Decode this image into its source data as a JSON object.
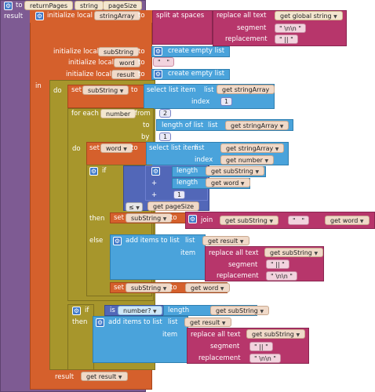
{
  "proc": {
    "to": "to",
    "name": "returnPages",
    "param1": "string",
    "param2": "pageSize",
    "result": "result"
  },
  "init": {
    "label": "initialize local",
    "var": "stringArray",
    "to": "to",
    "split": "split at spaces",
    "replace": "replace all text",
    "get": "get",
    "global": "global string",
    "segment": "segment",
    "replacement": "replacement",
    "seg_value": "\\n\\n",
    "rep_value": "||"
  },
  "locals": [
    {
      "label": "initialize local",
      "var": "subString",
      "to": "to",
      "value": "create empty list"
    },
    {
      "label": "initialize local",
      "var": "word",
      "to": "to",
      "value": ""
    },
    {
      "label": "initialize local",
      "var": "result",
      "to": "to",
      "value": "create empty list"
    }
  ],
  "in": "in",
  "do": "do",
  "set1": {
    "set": "set",
    "var": "subString",
    "to": "to",
    "select": "select list item",
    "list": "list",
    "get": "get",
    "listvar": "stringArray",
    "index": "index",
    "index_value": "1"
  },
  "foreach": {
    "label": "for each",
    "var": "number",
    "from": "from",
    "from_value": "2",
    "to": "to",
    "length": "length of list",
    "list": "list",
    "get": "get",
    "listvar": "stringArray",
    "by": "by",
    "by_value": "1",
    "do": "do"
  },
  "set2": {
    "set": "set",
    "var": "word",
    "to": "to",
    "select": "select list item",
    "list": "list",
    "get": "get",
    "listvar": "stringArray",
    "index": "index",
    "idxvar": "number"
  },
  "if1": {
    "if": "if",
    "length": "length",
    "get": "get",
    "a": "subString",
    "b": "word",
    "plus": "+",
    "one": "1",
    "le": "≤",
    "size": "pageSize"
  },
  "then1": {
    "then": "then",
    "set": "set",
    "var": "subString",
    "to": "to",
    "join": "join",
    "get": "get",
    "a": "subString",
    "sep": "",
    "b": "word"
  },
  "else1": {
    "else": "else",
    "add": "add items to list",
    "list": "list",
    "get": "get",
    "listvar": "result",
    "item": "item",
    "replace": "replace all text",
    "text": "subString",
    "segment": "segment",
    "replacement": "replacement",
    "seg_value": "||",
    "rep_value": "\\n\\n"
  },
  "set3": {
    "set": "set",
    "var": "subString",
    "to": "to",
    "get": "get",
    "val": "word"
  },
  "if2": {
    "if": "if",
    "is": "is",
    "isnum": "number?",
    "length": "length",
    "get": "get",
    "var": "subString"
  },
  "then2": {
    "then": "then",
    "add": "add items to list",
    "list": "list",
    "get": "get",
    "listvar": "result",
    "item": "item",
    "replace": "replace all text",
    "text": "subString",
    "segment": "segment",
    "replacement": "replacement",
    "seg_value": "||",
    "rep_value": "\\n\\n"
  },
  "ret": {
    "result": "result",
    "get": "get",
    "var": "result"
  }
}
